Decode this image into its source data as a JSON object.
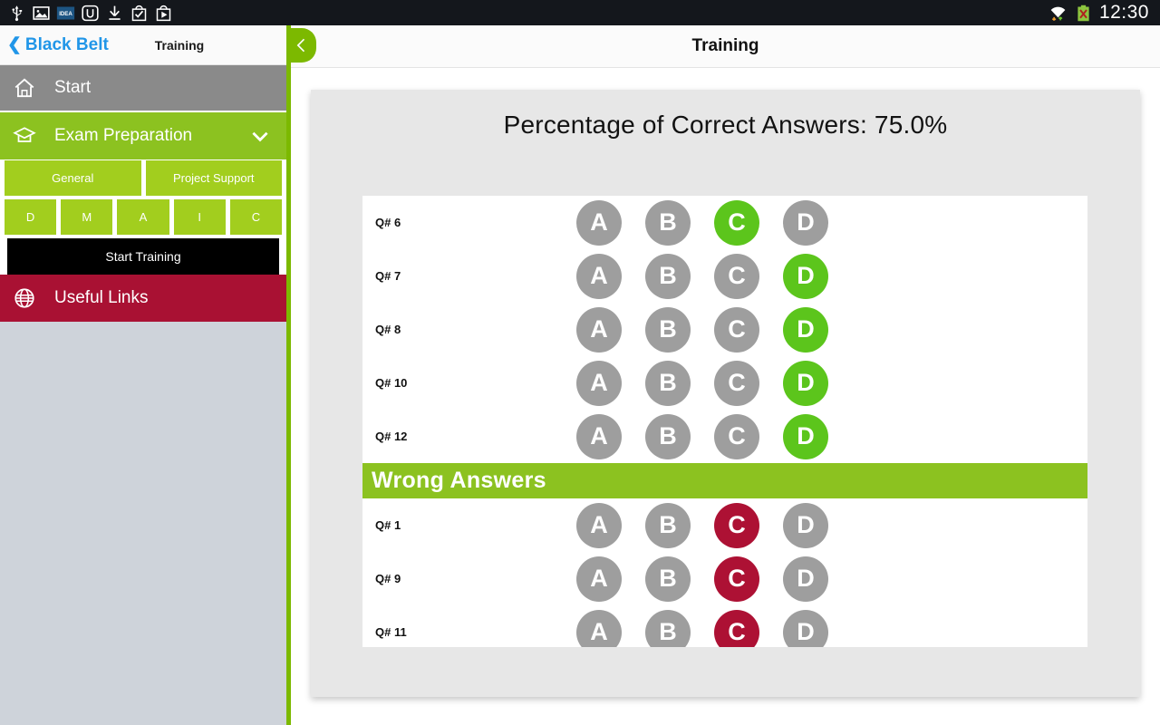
{
  "statusbar": {
    "time": "12:30",
    "left_icons": [
      "usb-icon",
      "image-icon",
      "idea-icon",
      "u-app-icon",
      "download-icon",
      "checkbag-icon",
      "playbag-icon"
    ],
    "right_icons": [
      "wifi-icon",
      "battery-error-icon"
    ]
  },
  "sidebar": {
    "back_chevron": "❮",
    "back_label": "Black Belt",
    "title": "Training",
    "items": [
      {
        "label": "Start",
        "icon": "home-icon",
        "style": "start"
      },
      {
        "label": "Exam Preparation",
        "icon": "graduation-cap-icon",
        "style": "exam",
        "chevron": "chevron-down-icon"
      },
      {
        "label": "Useful Links",
        "icon": "globe-icon",
        "style": "links"
      }
    ],
    "categories": [
      "General",
      "Project Support"
    ],
    "phases": [
      "D",
      "M",
      "A",
      "I",
      "C"
    ],
    "start_training_label": "Start Training"
  },
  "main": {
    "title": "Training",
    "back_icon": "chevron-left-icon",
    "card_title": "Percentage of Correct Answers:  75.0%",
    "percentage": "75.0%",
    "section_label": "Wrong Answers",
    "options": [
      "A",
      "B",
      "C",
      "D"
    ],
    "correct_rows": [
      {
        "question": "Q# 6",
        "selected": "C"
      },
      {
        "question": "Q# 7",
        "selected": "D"
      },
      {
        "question": "Q# 8",
        "selected": "D"
      },
      {
        "question": "Q# 10",
        "selected": "D"
      },
      {
        "question": "Q# 12",
        "selected": "D"
      }
    ],
    "wrong_rows": [
      {
        "question": "Q# 1",
        "selected": "C"
      },
      {
        "question": "Q# 9",
        "selected": "C"
      },
      {
        "question": "Q# 11",
        "selected": "C"
      }
    ]
  },
  "colors": {
    "accent_green": "#8cc220",
    "bright_green": "#5cc51c",
    "strip_green": "#7cb900",
    "crimson": "#a91133",
    "gray_option": "#9e9e9e",
    "link_blue": "#2196e8"
  }
}
